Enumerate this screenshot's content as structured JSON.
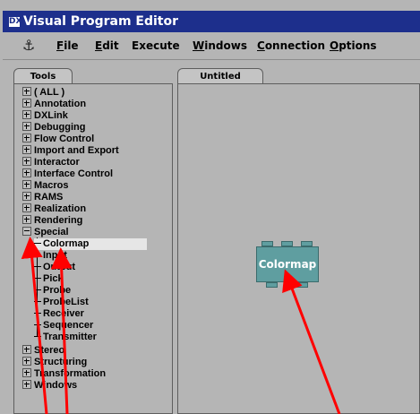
{
  "window": {
    "title": "Visual Program Editor",
    "sys_icon": "DX"
  },
  "menubar": {
    "anchor_icon": "anchor-icon",
    "items": [
      {
        "mnemonic": "F",
        "rest": "ile"
      },
      {
        "mnemonic": "E",
        "rest": "dit"
      },
      {
        "mnemonic": "",
        "rest": "Execute"
      },
      {
        "mnemonic": "W",
        "rest": "indows"
      },
      {
        "mnemonic": "C",
        "rest": "onnection"
      },
      {
        "mnemonic": "O",
        "rest": "ptions"
      }
    ]
  },
  "tools_tab": "Tools",
  "canvas_tab": "Untitled",
  "tree": {
    "categories_top": [
      "( ALL )",
      "Annotation",
      "DXLink",
      "Debugging",
      "Flow Control",
      "Import and Export",
      "Interactor",
      "Interface Control",
      "Macros",
      "RAMS",
      "Realization",
      "Rendering"
    ],
    "expanded": "Special",
    "special_children": [
      "Colormap",
      "Input",
      "Output",
      "Pick",
      "Probe",
      "ProbeList",
      "Receiver",
      "Sequencer",
      "Transmitter"
    ],
    "selected_child": "Colormap",
    "categories_bottom": [
      "Stereo",
      "Structuring",
      "Transformation",
      "Windows"
    ]
  },
  "canvas": {
    "node_label": "Colormap"
  },
  "colors": {
    "titlebar": "#1d2f8c",
    "node": "#5f9ea0",
    "arrow": "#ff0000",
    "background": "#b5b5b5"
  }
}
